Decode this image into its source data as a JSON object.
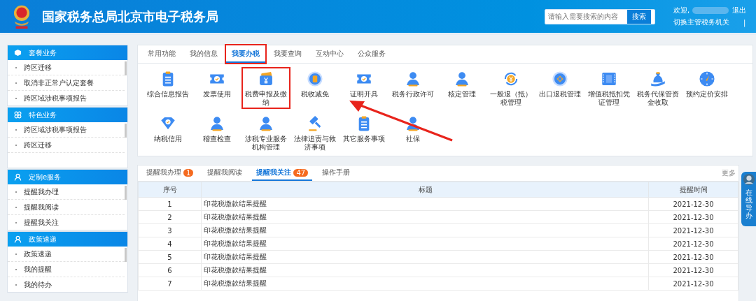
{
  "header": {
    "title": "国家税务总局北京市电子税务局",
    "search": {
      "placeholder": "请输入需要搜索的内容",
      "button": "搜索"
    },
    "welcome": "欢迎,",
    "logout": "退出",
    "switch_office": "切换主管税务机关",
    "separator": "|"
  },
  "sidebar": [
    {
      "title": "套餐业务",
      "items": [
        "跨区迁移",
        "取消非正常户认定套餐",
        "跨区域涉税事项报告"
      ]
    },
    {
      "title": "特色业务",
      "items": [
        "跨区域涉税事项报告",
        "跨区迁移"
      ]
    },
    {
      "title": "定制e服务",
      "items": [
        "提醒我办理",
        "提醒我阅读",
        "提醒我关注"
      ]
    },
    {
      "title": "政策速递",
      "items": [
        "政策速递",
        "我的提醒",
        "我的待办"
      ]
    }
  ],
  "tabs": [
    {
      "label": "常用功能",
      "selected": false,
      "highlighted": false
    },
    {
      "label": "我的信息",
      "selected": false,
      "highlighted": false
    },
    {
      "label": "我要办税",
      "selected": true,
      "highlighted": true
    },
    {
      "label": "我要查询",
      "selected": false,
      "highlighted": false
    },
    {
      "label": "互动中心",
      "selected": false,
      "highlighted": false
    },
    {
      "label": "公众服务",
      "selected": false,
      "highlighted": false
    }
  ],
  "services": [
    {
      "label": "综合信息报告",
      "highlighted": false
    },
    {
      "label": "发票使用",
      "highlighted": false
    },
    {
      "label": "税费申报及缴纳",
      "highlighted": true
    },
    {
      "label": "税收减免",
      "highlighted": false
    },
    {
      "label": "证明开具",
      "highlighted": false
    },
    {
      "label": "税务行政许可",
      "highlighted": false
    },
    {
      "label": "核定管理",
      "highlighted": false
    },
    {
      "label": "一般退（抵）税管理",
      "highlighted": false
    },
    {
      "label": "出口退税管理",
      "highlighted": false
    },
    {
      "label": "增值税抵扣凭证管理",
      "highlighted": false
    },
    {
      "label": "税务代保管资金收取",
      "highlighted": false
    },
    {
      "label": "预约定价安排",
      "highlighted": false
    },
    {
      "label": "纳税信用",
      "highlighted": false
    },
    {
      "label": "稽查检查",
      "highlighted": false
    },
    {
      "label": "涉税专业服务机构管理",
      "highlighted": false
    },
    {
      "label": "法律追责与救济事项",
      "highlighted": false
    },
    {
      "label": "其它服务事项",
      "highlighted": false
    },
    {
      "label": "社保",
      "highlighted": false
    }
  ],
  "reminder_tabs": [
    {
      "label": "提醒我办理",
      "badge": "1",
      "selected": false
    },
    {
      "label": "提醒我阅读",
      "selected": false
    },
    {
      "label": "提醒我关注",
      "badge": "47",
      "selected": true
    },
    {
      "label": "操作手册",
      "selected": false
    }
  ],
  "more": "更多",
  "table": {
    "columns": [
      "序号",
      "标题",
      "提醒时间"
    ],
    "rows": [
      [
        "1",
        "印花税缴款结果提醒",
        "2021-12-30"
      ],
      [
        "2",
        "印花税缴款结果提醒",
        "2021-12-30"
      ],
      [
        "3",
        "印花税缴款结果提醒",
        "2021-12-30"
      ],
      [
        "4",
        "印花税缴款结果提醒",
        "2021-12-30"
      ],
      [
        "5",
        "印花税缴款结果提醒",
        "2021-12-30"
      ],
      [
        "6",
        "印花税缴款结果提醒",
        "2021-12-30"
      ],
      [
        "7",
        "印花税缴款结果提醒",
        "2021-12-30"
      ]
    ]
  },
  "guide_widget": {
    "label": "在线导办"
  }
}
